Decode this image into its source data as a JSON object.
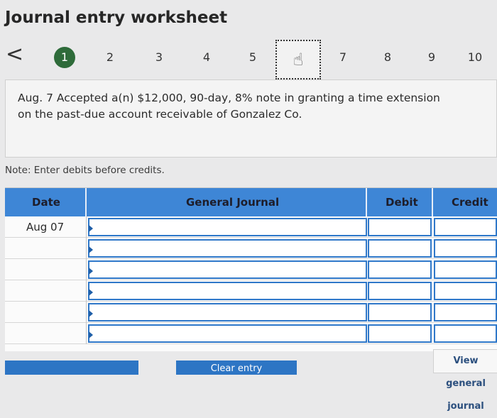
{
  "header": {
    "title": "Journal entry worksheet"
  },
  "nav": {
    "prev_glyph": "<",
    "steps": [
      "1",
      "2",
      "3",
      "4",
      "5",
      "",
      "7",
      "8",
      "9",
      "10"
    ],
    "active_step": "1",
    "current_step_icon": "hand-pointer-icon"
  },
  "question": {
    "line1": "Aug. 7 Accepted a(n) $12,000, 90-day, 8% note in granting a time extension",
    "line2": "on the past-due account receivable of Gonzalez Co."
  },
  "note": "Note: Enter debits before credits.",
  "table": {
    "headers": {
      "date": "Date",
      "journal": "General Journal",
      "debit": "Debit",
      "credit": "Credit"
    },
    "rows": [
      {
        "date": "Aug 07"
      },
      {
        "date": ""
      },
      {
        "date": ""
      },
      {
        "date": ""
      },
      {
        "date": ""
      },
      {
        "date": ""
      }
    ]
  },
  "buttons": {
    "clear": "Clear entry",
    "view": "View general journal"
  },
  "colors": {
    "accent": "#2f78c9",
    "active_step": "#2e6b3a"
  }
}
